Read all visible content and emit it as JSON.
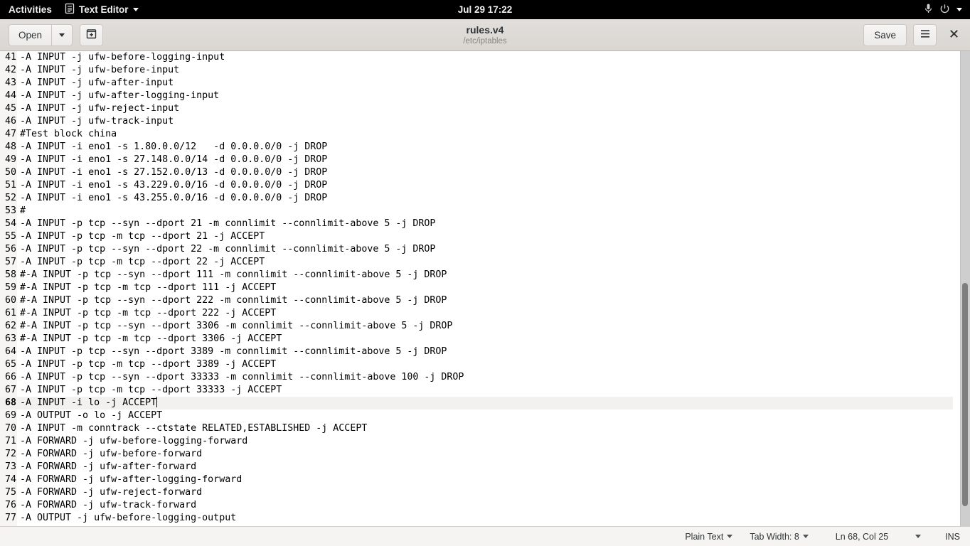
{
  "panel": {
    "activities": "Activities",
    "app_name": "Text Editor",
    "app_icon": "text-editor-icon",
    "app_menu_arrow": "chevron-down-icon",
    "clock": "Jul 29  17:22",
    "mic_icon": "microphone-icon",
    "power_icon": "power-icon",
    "system_menu_arrow": "chevron-down-icon",
    "background": "#000000"
  },
  "headerbar": {
    "open_label": "Open",
    "open_menu_icon": "chevron-down-icon",
    "new_document_icon": "new-document-icon",
    "title": "rules.v4",
    "subtitle": "/etc/iptables",
    "save_label": "Save",
    "menu_icon": "hamburger-menu-icon",
    "close_icon": "close-icon"
  },
  "editor": {
    "first_line_number": 41,
    "current_line": 68,
    "cursor_column": 25,
    "lines": [
      {
        "n": 41,
        "text": "-A INPUT -j ufw-before-logging-input"
      },
      {
        "n": 42,
        "text": "-A INPUT -j ufw-before-input"
      },
      {
        "n": 43,
        "text": "-A INPUT -j ufw-after-input"
      },
      {
        "n": 44,
        "text": "-A INPUT -j ufw-after-logging-input"
      },
      {
        "n": 45,
        "text": "-A INPUT -j ufw-reject-input"
      },
      {
        "n": 46,
        "text": "-A INPUT -j ufw-track-input"
      },
      {
        "n": 47,
        "text": "#Test block china"
      },
      {
        "n": 48,
        "text": "-A INPUT -i eno1 -s 1.80.0.0/12   -d 0.0.0.0/0 -j DROP"
      },
      {
        "n": 49,
        "text": "-A INPUT -i eno1 -s 27.148.0.0/14 -d 0.0.0.0/0 -j DROP"
      },
      {
        "n": 50,
        "text": "-A INPUT -i eno1 -s 27.152.0.0/13 -d 0.0.0.0/0 -j DROP"
      },
      {
        "n": 51,
        "text": "-A INPUT -i eno1 -s 43.229.0.0/16 -d 0.0.0.0/0 -j DROP"
      },
      {
        "n": 52,
        "text": "-A INPUT -i eno1 -s 43.255.0.0/16 -d 0.0.0.0/0 -j DROP"
      },
      {
        "n": 53,
        "text": "#"
      },
      {
        "n": 54,
        "text": "-A INPUT -p tcp --syn --dport 21 -m connlimit --connlimit-above 5 -j DROP"
      },
      {
        "n": 55,
        "text": "-A INPUT -p tcp -m tcp --dport 21 -j ACCEPT"
      },
      {
        "n": 56,
        "text": "-A INPUT -p tcp --syn --dport 22 -m connlimit --connlimit-above 5 -j DROP"
      },
      {
        "n": 57,
        "text": "-A INPUT -p tcp -m tcp --dport 22 -j ACCEPT"
      },
      {
        "n": 58,
        "text": "#-A INPUT -p tcp --syn --dport 111 -m connlimit --connlimit-above 5 -j DROP"
      },
      {
        "n": 59,
        "text": "#-A INPUT -p tcp -m tcp --dport 111 -j ACCEPT"
      },
      {
        "n": 60,
        "text": "#-A INPUT -p tcp --syn --dport 222 -m connlimit --connlimit-above 5 -j DROP"
      },
      {
        "n": 61,
        "text": "#-A INPUT -p tcp -m tcp --dport 222 -j ACCEPT"
      },
      {
        "n": 62,
        "text": "#-A INPUT -p tcp --syn --dport 3306 -m connlimit --connlimit-above 5 -j DROP"
      },
      {
        "n": 63,
        "text": "#-A INPUT -p tcp -m tcp --dport 3306 -j ACCEPT"
      },
      {
        "n": 64,
        "text": "-A INPUT -p tcp --syn --dport 3389 -m connlimit --connlimit-above 5 -j DROP"
      },
      {
        "n": 65,
        "text": "-A INPUT -p tcp -m tcp --dport 3389 -j ACCEPT"
      },
      {
        "n": 66,
        "text": "-A INPUT -p tcp --syn --dport 33333 -m connlimit --connlimit-above 100 -j DROP"
      },
      {
        "n": 67,
        "text": "-A INPUT -p tcp -m tcp --dport 33333 -j ACCEPT"
      },
      {
        "n": 68,
        "text": "-A INPUT -i lo -j ACCEPT"
      },
      {
        "n": 69,
        "text": "-A OUTPUT -o lo -j ACCEPT"
      },
      {
        "n": 70,
        "text": "-A INPUT -m conntrack --ctstate RELATED,ESTABLISHED -j ACCEPT"
      },
      {
        "n": 71,
        "text": "-A FORWARD -j ufw-before-logging-forward"
      },
      {
        "n": 72,
        "text": "-A FORWARD -j ufw-before-forward"
      },
      {
        "n": 73,
        "text": "-A FORWARD -j ufw-after-forward"
      },
      {
        "n": 74,
        "text": "-A FORWARD -j ufw-after-logging-forward"
      },
      {
        "n": 75,
        "text": "-A FORWARD -j ufw-reject-forward"
      },
      {
        "n": 76,
        "text": "-A FORWARD -j ufw-track-forward"
      },
      {
        "n": 77,
        "text": "-A OUTPUT -j ufw-before-logging-output"
      }
    ]
  },
  "statusbar": {
    "language": "Plain Text",
    "language_arrow": "chevron-down-icon",
    "tab_width": "Tab Width: 8",
    "tab_width_arrow": "chevron-down-icon",
    "position": "Ln 68, Col 25",
    "position_arrow": "chevron-down-icon",
    "insert_mode": "INS"
  },
  "colors": {
    "panel_bg": "#000000",
    "headerbar_bg": "#dad6d2",
    "editor_bg": "#ffffff",
    "gutter_bg": "#f6f5f4",
    "current_line_bg": "#f2f1f0",
    "statusbar_bg": "#f5f4f2",
    "text_fg": "#000000",
    "scrollbar_thumb": "#7e7e7e"
  }
}
